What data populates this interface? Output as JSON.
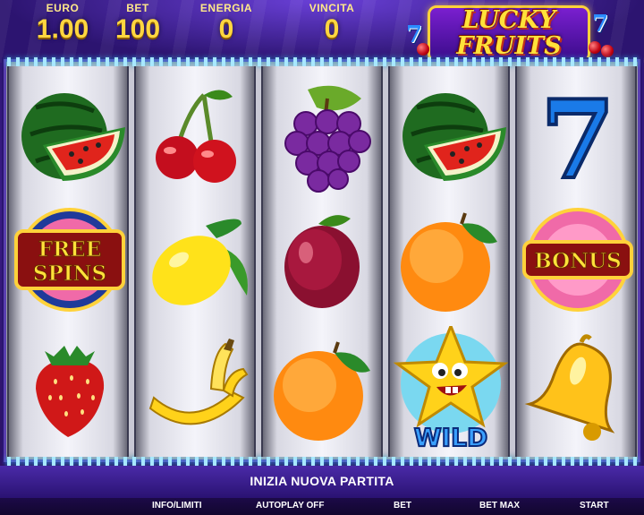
{
  "header": {
    "euro": {
      "label": "EURO",
      "value": "1.00"
    },
    "bet": {
      "label": "BET",
      "value": "100"
    },
    "energia": {
      "label": "ENERGIA",
      "value": "0"
    },
    "vincita": {
      "label": "VINCITA",
      "value": "0"
    }
  },
  "logo": {
    "line1": "LUCKY",
    "line2": "FRUITS"
  },
  "reels": [
    [
      "watermelon",
      "free-spins",
      "strawberry"
    ],
    [
      "cherry",
      "lemon",
      "banana"
    ],
    [
      "grapes",
      "plum",
      "orange"
    ],
    [
      "watermelon",
      "orange",
      "wild-star"
    ],
    [
      "seven",
      "bonus",
      "bell"
    ]
  ],
  "symbols": {
    "free_spins_line1": "FREE",
    "free_spins_line2": "SPINS",
    "bonus": "BONUS",
    "wild": "WILD",
    "seven": "7"
  },
  "message": "INIZIA NUOVA PARTITA",
  "controls": {
    "info": "INFO/LIMITI",
    "autoplay": "AUTOPLAY OFF",
    "bet": "BET",
    "bet_max": "BET MAX",
    "start": "START"
  },
  "colors": {
    "accent": "#ffd640",
    "frame": "#5a3fb0",
    "background": "#2c1470"
  }
}
